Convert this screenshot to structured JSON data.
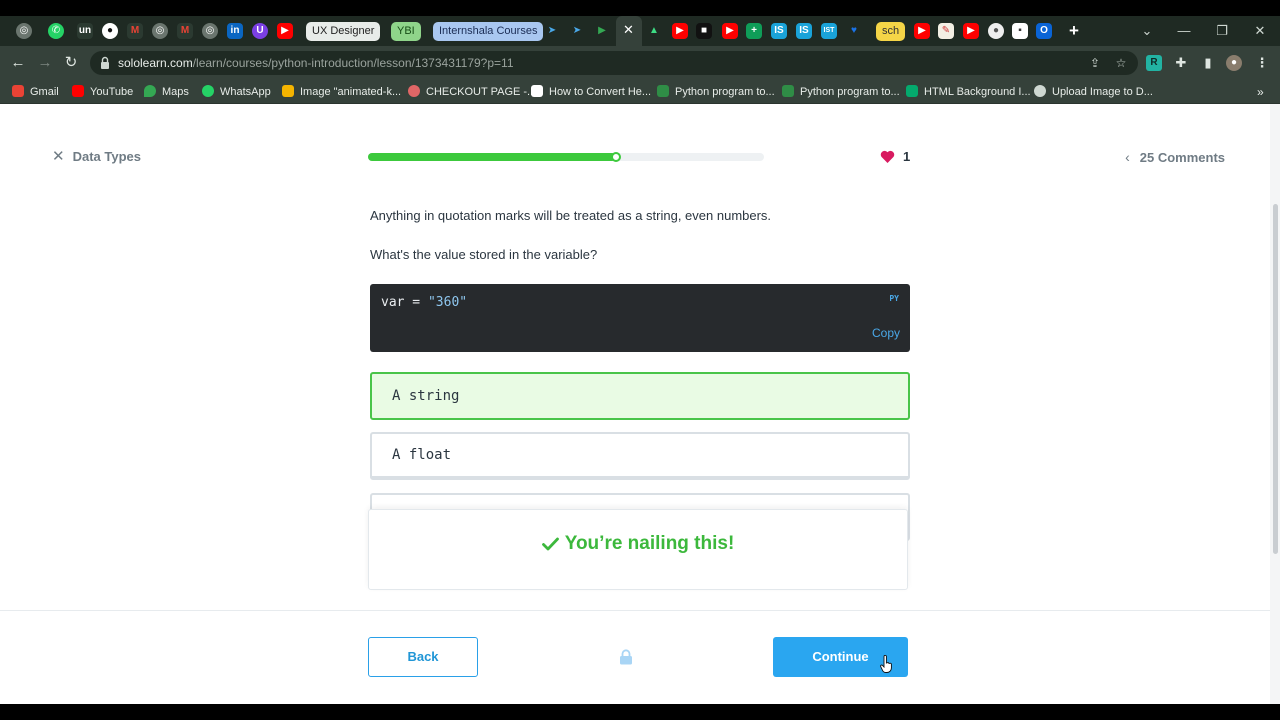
{
  "browser": {
    "tabs": {
      "ux_designer": "UX Designer",
      "ybi": "YBI",
      "internshala": "Internshala Courses",
      "sch": "sch",
      "unstop_fav": "un",
      "linkedin_fav": "in",
      "ist_fav": "IST"
    },
    "url_domain": "sololearn.com",
    "url_path": "/learn/courses/python-introduction/lesson/1373431179?p=11",
    "bookmarks": [
      "Gmail",
      "YouTube",
      "Maps",
      "WhatsApp",
      "Image \"animated-k...",
      "CHECKOUT PAGE -...",
      "How to Convert He...",
      "Python program to...",
      "Python program to...",
      "HTML Background I...",
      "Upload Image to D..."
    ],
    "more_bookmarks": "»"
  },
  "lesson": {
    "close_label": "Data Types",
    "progress_fraction": 0.625,
    "hearts": "1",
    "comments": "25 Comments"
  },
  "content": {
    "para1": "Anything in quotation marks will be treated as a string, even numbers.",
    "para2": "What's the value stored in the variable?",
    "code_prefix": "var = ",
    "code_string": "\"360\"",
    "code_lang": "PY",
    "copy_label": "Copy",
    "options": [
      "A string",
      "A float",
      ""
    ],
    "feedback": "You’re nailing this!"
  },
  "footer": {
    "back": "Back",
    "continue": "Continue"
  },
  "colors": {
    "brand_blue": "#2aa6f0",
    "success_green": "#3cc93c",
    "heart_red": "#d81b60"
  }
}
